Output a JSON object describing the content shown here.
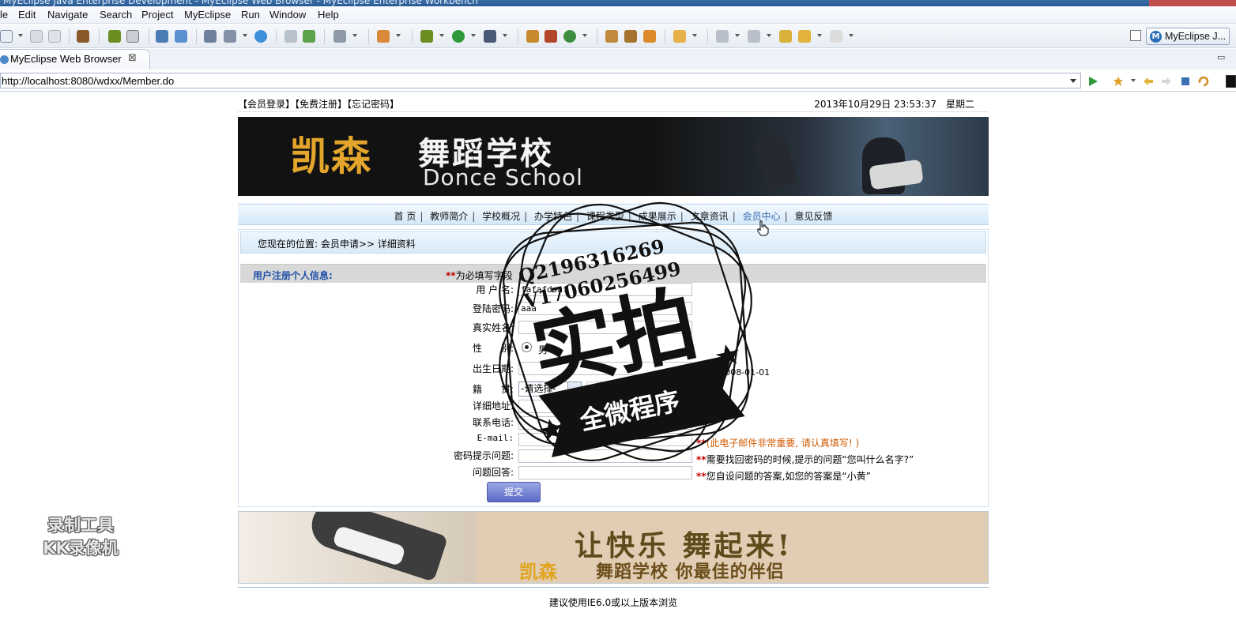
{
  "window": {
    "title": "MyEclipse Java Enterprise Development - MyEclipse Web Browser - MyEclipse Enterprise Workbench"
  },
  "menubar": [
    "le",
    "Edit",
    "Navigate",
    "Search",
    "Project",
    "MyEclipse",
    "Run",
    "Window",
    "Help"
  ],
  "toolbar": {
    "perspective_label": "MyEclipse J..."
  },
  "editor_tab": {
    "label": "MyEclipse Web Browser",
    "close": "⊠"
  },
  "browser": {
    "url": "http://localhost:8080/wdxx/Member.do"
  },
  "site": {
    "top_links": [
      "【会员登录】",
      "【免费注册】",
      "【忘记密码】"
    ],
    "clock": "2013年10月29日  23:53:37　星期二",
    "banner": {
      "cn_brand": "凯森",
      "cn_name": "舞蹈学校",
      "en_name": "Donce School"
    },
    "nav": [
      "首 页",
      "教师简介",
      "学校概况",
      "办学特色",
      "课程类型",
      "成果展示",
      "文章资讯",
      "会员中心",
      "意见反馈"
    ],
    "nav_active": "会员中心",
    "breadcrumb": "您现在的位置: 会员申请>> 详细资料",
    "form_title": "用户注册个人信息:",
    "required_marker": "**",
    "required_note": "为必填写字段",
    "fields": {
      "username": {
        "label": "用 户 名:",
        "value": "fafafdsaf"
      },
      "password": {
        "label": "登陆密码:",
        "value": "aaa"
      },
      "realname": {
        "label": "真实姓名:",
        "value": ""
      },
      "gender": {
        "label": "性　　别:",
        "option_male": "男"
      },
      "birthday": {
        "label": "出生日期:",
        "value": "",
        "hint": "格式: 2008-01-01"
      },
      "origin": {
        "label": "籍　　贯:",
        "selected": "-请选择-"
      },
      "address": {
        "label": "详细地址:",
        "value": ""
      },
      "phone": {
        "label": "联系电话:",
        "value": ""
      },
      "email": {
        "label": "E-mail:",
        "value": "",
        "note": "(此电子邮件非常重要, 请认真填写! )"
      },
      "question": {
        "label": "密码提示问题:",
        "value": "",
        "note": "需要找回密码的时候,提示的问题“您叫什么名字?”"
      },
      "answer": {
        "label": "问题回答:",
        "value": "",
        "note": "您自设问题的答案,如您的答案是“小黄”"
      }
    },
    "submit_label": "提交",
    "banner2": {
      "slogan": "让快乐 舞起来!",
      "brand": "凯森",
      "tagline": "舞蹈学校 你最佳的伴侣"
    },
    "footer": "建议使用IE6.0或以上版本浏览"
  },
  "stamp": {
    "line1": "Q2196316269",
    "line2": "V17060256499",
    "big": "实拍",
    "ribbon": "全微程序"
  },
  "watermark": {
    "line1": "录制工具",
    "line2": "KK录像机"
  },
  "colors": {
    "nav_bg": "#d4e8f8",
    "form_title": "#1f50a8",
    "required": "#c00000",
    "submit": "#5b69c6",
    "email_note": "#d05a00"
  }
}
